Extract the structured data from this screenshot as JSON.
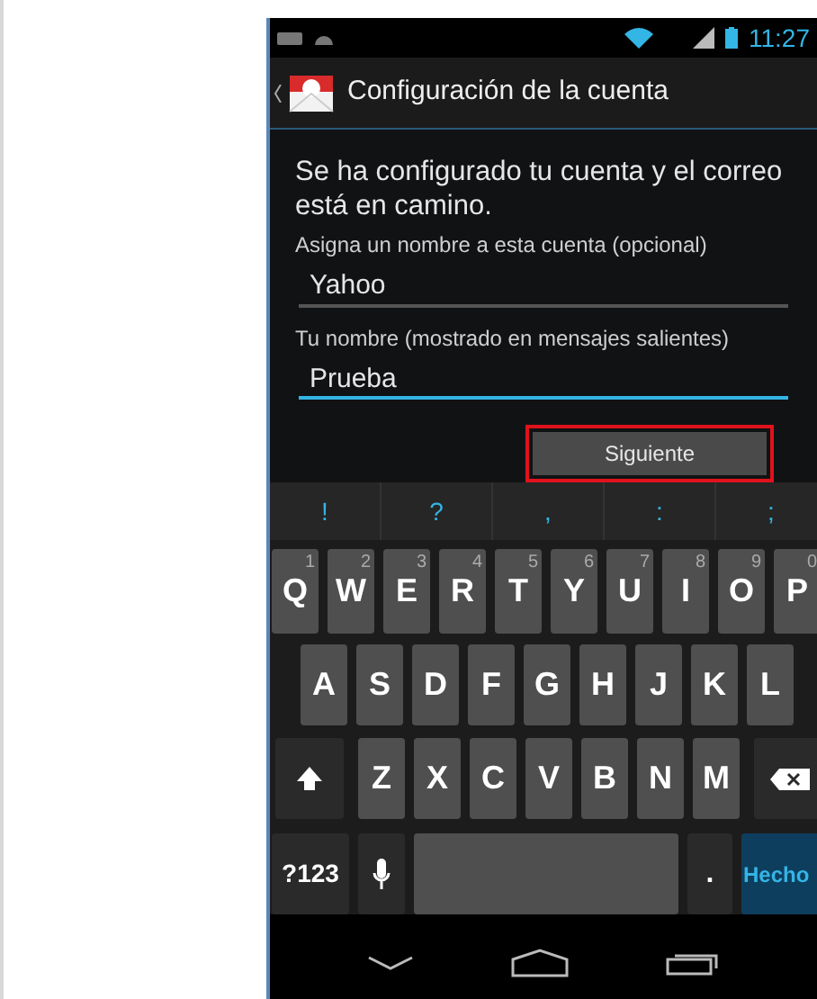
{
  "status_bar": {
    "time": "11:27"
  },
  "action_bar": {
    "title": "Configuración de la cuenta"
  },
  "message": "Se ha configurado tu cuenta y el correo está en camino.",
  "fields": [
    {
      "label": "Asigna un nombre a esta cuenta (opcional)",
      "value": "Yahoo",
      "focused": false
    },
    {
      "label": "Tu nombre (mostrado en mensajes salientes)",
      "value": "Prueba",
      "focused": true
    }
  ],
  "next_button": {
    "label": "Siguiente",
    "highlighted": true
  },
  "keyboard": {
    "suggestions": [
      "!",
      "?",
      ",",
      ":",
      ";"
    ],
    "rows": [
      {
        "keys": [
          {
            "kind": "letter",
            "label": "Q",
            "hint": "1"
          },
          {
            "kind": "letter",
            "label": "W",
            "hint": "2"
          },
          {
            "kind": "letter",
            "label": "E",
            "hint": "3"
          },
          {
            "kind": "letter",
            "label": "R",
            "hint": "4"
          },
          {
            "kind": "letter",
            "label": "T",
            "hint": "5"
          },
          {
            "kind": "letter",
            "label": "Y",
            "hint": "6"
          },
          {
            "kind": "letter",
            "label": "U",
            "hint": "7"
          },
          {
            "kind": "letter",
            "label": "I",
            "hint": "8"
          },
          {
            "kind": "letter",
            "label": "O",
            "hint": "9"
          },
          {
            "kind": "letter",
            "label": "P",
            "hint": "0"
          }
        ]
      },
      {
        "keys": [
          {
            "kind": "letter",
            "label": "A"
          },
          {
            "kind": "letter",
            "label": "S"
          },
          {
            "kind": "letter",
            "label": "D"
          },
          {
            "kind": "letter",
            "label": "F"
          },
          {
            "kind": "letter",
            "label": "G"
          },
          {
            "kind": "letter",
            "label": "H"
          },
          {
            "kind": "letter",
            "label": "J"
          },
          {
            "kind": "letter",
            "label": "K"
          },
          {
            "kind": "letter",
            "label": "L"
          }
        ]
      },
      {
        "keys": [
          {
            "kind": "shift"
          },
          {
            "kind": "letter",
            "label": "Z"
          },
          {
            "kind": "letter",
            "label": "X"
          },
          {
            "kind": "letter",
            "label": "C"
          },
          {
            "kind": "letter",
            "label": "V"
          },
          {
            "kind": "letter",
            "label": "B"
          },
          {
            "kind": "letter",
            "label": "N"
          },
          {
            "kind": "letter",
            "label": "M"
          },
          {
            "kind": "delete"
          }
        ]
      },
      {
        "keys": [
          {
            "kind": "symbols",
            "label": "?123"
          },
          {
            "kind": "mic"
          },
          {
            "kind": "space"
          },
          {
            "kind": "period",
            "label": "."
          },
          {
            "kind": "done",
            "label": "Hecho"
          }
        ]
      }
    ]
  }
}
